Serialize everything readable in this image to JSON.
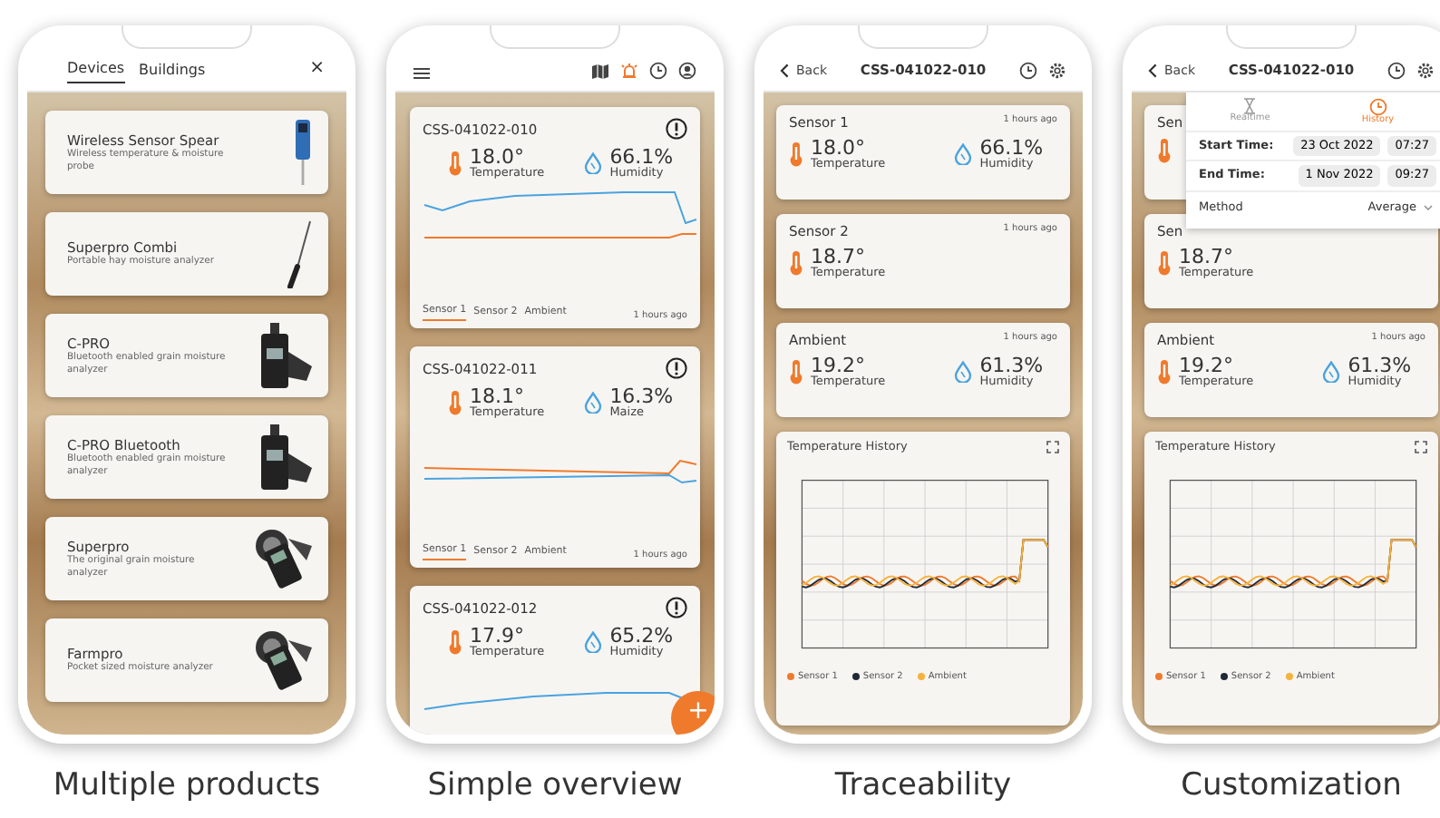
{
  "phones": [
    {
      "kind": "devices",
      "caption": "Multiple products",
      "tabs": [
        {
          "label": "Devices",
          "selected": true
        },
        {
          "label": "Buildings",
          "selected": false
        }
      ],
      "close": "×",
      "devices": [
        {
          "kind": "spear",
          "name": "Wireless Sensor Spear",
          "description": "Wireless temperature & moisture probe"
        },
        {
          "kind": "rod",
          "name": "Superpro Combi",
          "description": "Portable hay moisture analyzer"
        },
        {
          "kind": "meter",
          "name": "C-PRO",
          "description": "Bluetooth enabled grain moisture analyzer"
        },
        {
          "kind": "meter",
          "name": "C-PRO Bluetooth",
          "description": "Bluetooth enabled grain moisture analyzer"
        },
        {
          "kind": "handheld",
          "name": "Superpro",
          "description": "The original grain moisture analyzer"
        },
        {
          "kind": "handheld",
          "name": "Farmpro",
          "description": "Pocket sized moisture analyzer"
        }
      ]
    },
    {
      "kind": "overview",
      "caption": "Simple overview",
      "header_icons": [
        {
          "kind": "map",
          "selected": false
        },
        {
          "kind": "alarm",
          "selected": true
        },
        {
          "kind": "clock",
          "selected": false
        },
        {
          "kind": "user",
          "selected": false
        }
      ],
      "fab": "+",
      "cards": [
        {
          "title": "CSS-041022-010",
          "temperature": "18.0°",
          "temperature_label": "Temperature",
          "humidity": "66.1%",
          "humidity_label": "Humidity",
          "tabs": [
            {
              "label": "Sensor 1",
              "selected": true
            },
            {
              "label": "Sensor 2",
              "selected": false
            },
            {
              "label": "Ambient",
              "selected": false
            }
          ],
          "time": "1 hours ago"
        },
        {
          "title": "CSS-041022-011",
          "temperature": "18.1°",
          "temperature_label": "Temperature",
          "humidity": "16.3%",
          "humidity_label": "Maize",
          "tabs": [
            {
              "label": "Sensor 1",
              "selected": true
            },
            {
              "label": "Sensor 2",
              "selected": false
            },
            {
              "label": "Ambient",
              "selected": false
            }
          ],
          "time": "1 hours ago"
        },
        {
          "title": "CSS-041022-012",
          "temperature": "17.9°",
          "temperature_label": "Temperature",
          "humidity": "65.2%",
          "humidity_label": "Humidity"
        }
      ]
    },
    {
      "kind": "detail",
      "caption": "Traceability",
      "back": "Back",
      "title": "CSS-041022-010",
      "sensors": [
        {
          "name": "Sensor 1",
          "time": "1 hours ago",
          "temperature": "18.0°",
          "temperature_label": "Temperature",
          "humidity": "66.1%",
          "humidity_label": "Humidity"
        },
        {
          "name": "Sensor 2",
          "time": "1 hours ago",
          "temperature": "18.7°",
          "temperature_label": "Temperature"
        },
        {
          "name": "Ambient",
          "time": "1 hours ago",
          "temperature": "19.2°",
          "temperature_label": "Temperature",
          "humidity": "61.3%",
          "humidity_label": "Humidity"
        }
      ],
      "history": {
        "title": "Temperature History",
        "legend": [
          {
            "name": "Sensor 1",
            "color": "#f07a2c"
          },
          {
            "name": "Sensor 2",
            "color": "#1f2937"
          },
          {
            "name": "Ambient",
            "color": "#f6b33c"
          }
        ]
      }
    },
    {
      "kind": "detail",
      "caption": "Customization",
      "back": "Back",
      "title": "CSS-041022-010",
      "sensors": [
        {
          "name": "Sen"
        },
        {
          "name": "Sen",
          "temperature": "18.7°",
          "temperature_label": "Temperature"
        },
        {
          "name": "Ambient",
          "time": "1 hours ago",
          "temperature": "19.2°",
          "temperature_label": "Temperature",
          "humidity": "61.3%",
          "humidity_label": "Humidity"
        }
      ],
      "history": {
        "title": "Temperature History",
        "legend": [
          {
            "name": "Sensor 1",
            "color": "#f07a2c"
          },
          {
            "name": "Sensor 2",
            "color": "#1f2937"
          },
          {
            "name": "Ambient",
            "color": "#f6b33c"
          }
        ]
      },
      "popover": {
        "modes": [
          {
            "kind": "realtime",
            "label": "Realtime",
            "selected": false
          },
          {
            "kind": "history",
            "label": "History",
            "selected": true
          }
        ],
        "rows": [
          {
            "label": "Start Time:",
            "date": "23 Oct 2022",
            "time": "07:27"
          },
          {
            "label": "End Time:",
            "date": "1 Nov 2022",
            "time": "09:27"
          }
        ],
        "method_label": "Method",
        "method": "Average"
      }
    }
  ]
}
